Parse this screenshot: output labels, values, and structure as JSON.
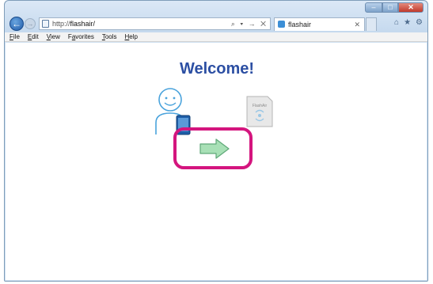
{
  "browser": {
    "url_prefix": "http://",
    "url_host": "flashair/",
    "address_controls": "⌕ ▾ → ✕",
    "tab_label": "flashair",
    "tab_close": "✕",
    "back_glyph": "←",
    "forward_glyph": "→",
    "window_controls": {
      "minimize": "–",
      "maximize": "□",
      "close": "✕"
    },
    "tools": {
      "home": "⌂",
      "favorites": "★",
      "settings": "⚙"
    }
  },
  "menubar": {
    "items": [
      {
        "accel": "F",
        "rest": "ile"
      },
      {
        "accel": "E",
        "rest": "dit"
      },
      {
        "accel": "V",
        "rest": "iew"
      },
      {
        "prefix": "F",
        "accel": "a",
        "rest": "vorites"
      },
      {
        "accel": "T",
        "rest": "ools"
      },
      {
        "accel": "H",
        "rest": "elp"
      }
    ]
  },
  "page": {
    "heading": "Welcome!",
    "card_label": "FlashAir",
    "highlight_color": "#d4157e",
    "arrow_color": "#a8e0b6",
    "heading_color": "#2c4fa3"
  },
  "icons": {
    "person": "person-with-phone-icon",
    "card": "flashair-card-icon",
    "arrow": "right-arrow-icon"
  }
}
